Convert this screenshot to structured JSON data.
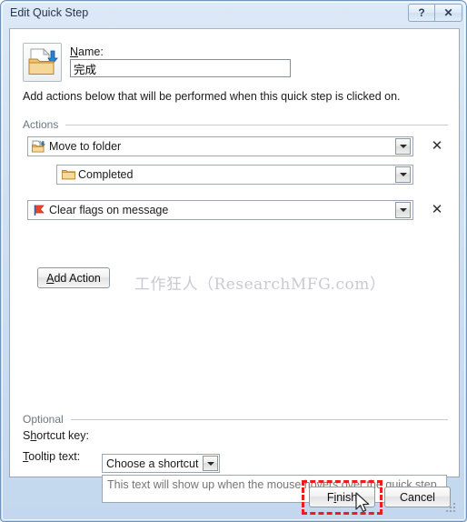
{
  "window": {
    "title": "Edit Quick Step",
    "caption_buttons": [
      {
        "name": "help-button",
        "glyph": "?"
      },
      {
        "name": "close-button",
        "glyph": "✕"
      }
    ]
  },
  "header": {
    "icon": "move-to-folder-icon",
    "name_label": "Name:",
    "name_value": "完成",
    "description": "Add actions below that will be performed when this quick step is clicked on."
  },
  "actions": {
    "group_label": "Actions",
    "rows": [
      {
        "icon": "move-to-folder-icon",
        "label": "Move to folder",
        "dropdown": "chevron-down-icon",
        "delete": "✕"
      },
      {
        "icon": "folder-icon",
        "label": "Completed",
        "dropdown": "chevron-down-icon",
        "indent": true
      },
      {
        "icon": "clear-flag-icon",
        "label": "Clear flags on message",
        "dropdown": "chevron-down-icon",
        "delete": "✕"
      }
    ],
    "add_action_label": "Add Action",
    "add_action_accel": "A"
  },
  "watermark": {
    "text": "工作狂人（ResearchMFG.com）"
  },
  "optional": {
    "group_label": "Optional",
    "shortcut_label": "Shortcut key:",
    "shortcut_accel": "h",
    "shortcut_value": "Choose a shortcut",
    "tooltip_label": "Tooltip text:",
    "tooltip_accel": "T",
    "tooltip_placeholder": "This text will show up when the mouse hovers over the quick step."
  },
  "footer": {
    "finish_label": "Finish",
    "cancel_label": "Cancel"
  },
  "colors": {
    "highlight": "#ee1c1c",
    "titlebar_text": "#25354a",
    "group_label": "#6c7680",
    "watermark": "#c9c9d2"
  }
}
